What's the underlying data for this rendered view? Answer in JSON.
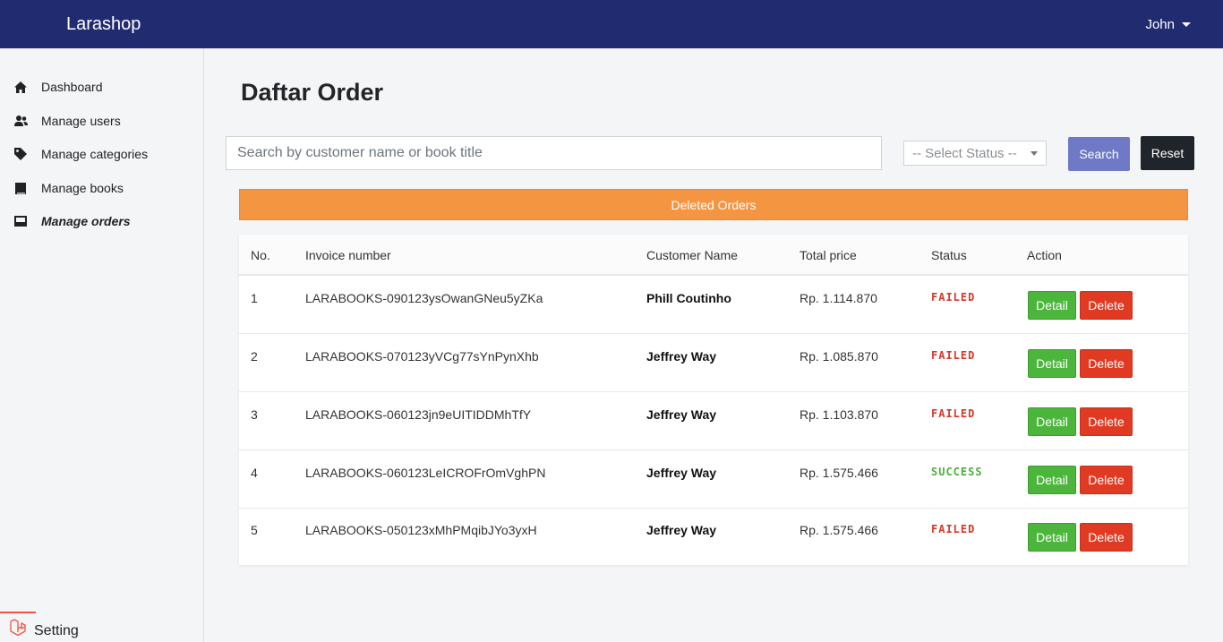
{
  "app": {
    "brand": "Larashop",
    "user_name": "John"
  },
  "sidebar": {
    "items": [
      {
        "label": "Dashboard",
        "icon": "home-icon"
      },
      {
        "label": "Manage users",
        "icon": "users-icon"
      },
      {
        "label": "Manage categories",
        "icon": "tag-icon"
      },
      {
        "label": "Manage books",
        "icon": "book-icon"
      },
      {
        "label": "Manage orders",
        "icon": "inbox-icon",
        "active": true
      }
    ],
    "setting_label": "Setting"
  },
  "page": {
    "title": "Daftar Order"
  },
  "filters": {
    "search_placeholder": "Search by customer name or book title",
    "status_placeholder": "-- Select Status --",
    "search_label": "Search",
    "reset_label": "Reset"
  },
  "deleted_banner": "Deleted Orders",
  "table": {
    "headers": [
      "No.",
      "Invoice number",
      "Customer Name",
      "Total price",
      "Status",
      "Action"
    ],
    "detail_label": "Detail",
    "delete_label": "Delete",
    "rows": [
      {
        "no": "1",
        "invoice": "LARABOOKS-090123ysOwanGNeu5yZKa",
        "customer": "Phill Coutinho",
        "total": "Rp. 1.114.870",
        "status": "FAILED"
      },
      {
        "no": "2",
        "invoice": "LARABOOKS-070123yVCg77sYnPynXhb",
        "customer": "Jeffrey Way",
        "total": "Rp. 1.085.870",
        "status": "FAILED"
      },
      {
        "no": "3",
        "invoice": "LARABOOKS-060123jn9eUITIDDMhTfY",
        "customer": "Jeffrey Way",
        "total": "Rp. 1.103.870",
        "status": "FAILED"
      },
      {
        "no": "4",
        "invoice": "LARABOOKS-060123LeICROFrOmVghPN",
        "customer": "Jeffrey Way",
        "total": "Rp. 1.575.466",
        "status": "SUCCESS"
      },
      {
        "no": "5",
        "invoice": "LARABOOKS-050123xMhPMqibJYo3yxH",
        "customer": "Jeffrey Way",
        "total": "Rp. 1.575.466",
        "status": "FAILED"
      }
    ]
  },
  "colors": {
    "navbar": "#212b70",
    "banner": "#f49542",
    "failed": "#d2392b",
    "success": "#4cae3c",
    "detail": "#4cb63c",
    "delete": "#e03a22",
    "search_button": "#6f79c6"
  }
}
